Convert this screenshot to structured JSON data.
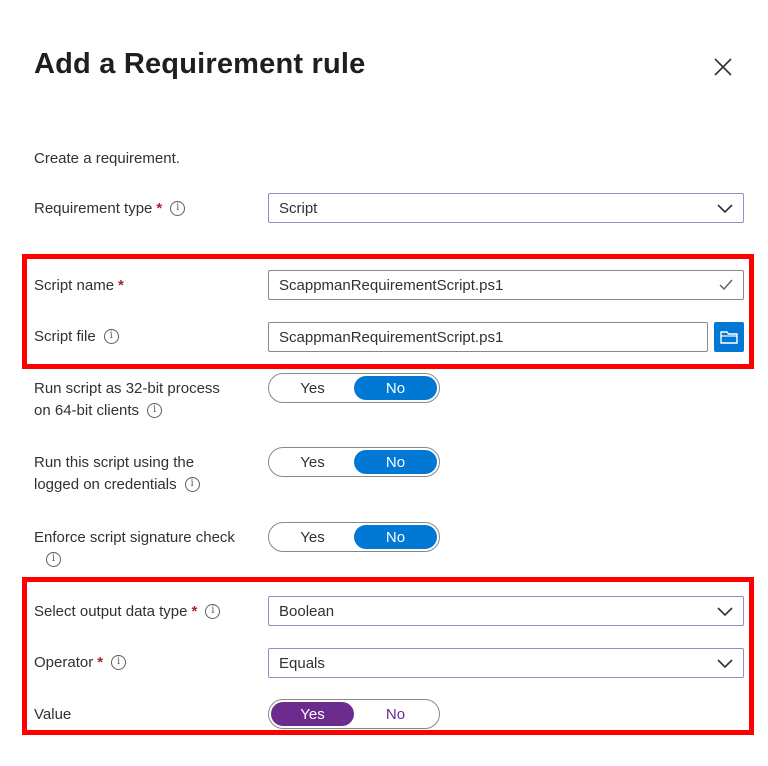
{
  "header": {
    "title": "Add a Requirement rule"
  },
  "subtitle": "Create a requirement.",
  "requirement_type": {
    "label": "Requirement type",
    "value": "Script"
  },
  "script_name": {
    "label": "Script name",
    "value": "ScappmanRequirementScript.ps1"
  },
  "script_file": {
    "label": "Script file",
    "value": "ScappmanRequirementScript.ps1"
  },
  "run_32bit": {
    "label_line1": "Run script as 32-bit process",
    "label_line2": "on 64-bit clients",
    "yes": "Yes",
    "no": "No",
    "selected": "No"
  },
  "run_logged_on": {
    "label_line1": "Run this script using the",
    "label_line2": "logged on credentials",
    "yes": "Yes",
    "no": "No",
    "selected": "No"
  },
  "enforce_signature": {
    "label": "Enforce script signature check",
    "yes": "Yes",
    "no": "No",
    "selected": "No"
  },
  "output_data_type": {
    "label": "Select output data type",
    "value": "Boolean"
  },
  "operator": {
    "label": "Operator",
    "value": "Equals"
  },
  "value": {
    "label": "Value",
    "yes": "Yes",
    "no": "No",
    "selected": "Yes"
  },
  "required_marker": "*",
  "info_glyph": "i",
  "colors": {
    "accent_blue": "#0078d4",
    "accent_purple": "#6b2c8e",
    "highlight_red": "#ff0000",
    "required_red": "#a4262c"
  }
}
